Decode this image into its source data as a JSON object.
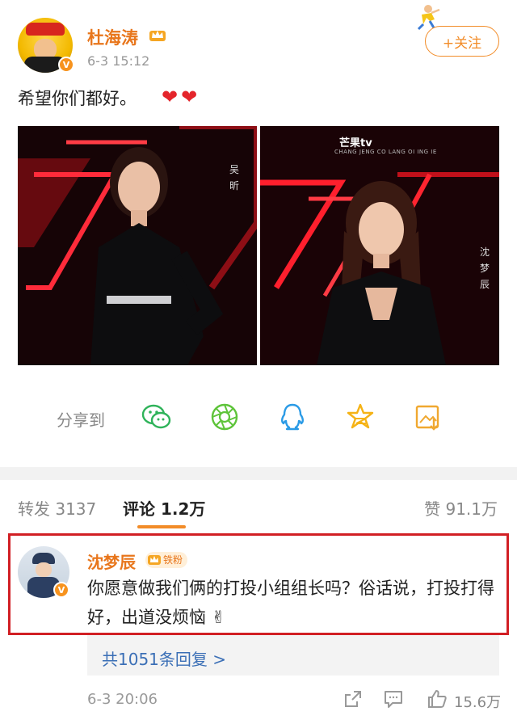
{
  "post": {
    "author": "杜海涛",
    "time": "6-3 15:12",
    "follow_label": "+关注",
    "text": "希望你们都好。",
    "hearts": [
      "❤",
      "❤"
    ],
    "photo_left_caption": [
      "吴",
      "昕"
    ],
    "photo_right_caption": [
      "沈",
      "梦",
      "辰"
    ],
    "photo_right_logo": "芒果tv",
    "photo_right_subtitle": "CHANG  JENG  CO  LANG  OI  ING  IE"
  },
  "share": {
    "label": "分享到",
    "icons": [
      "wechat-icon",
      "moments-icon",
      "qq-icon",
      "qzone-icon",
      "save-image-icon"
    ]
  },
  "tabs": {
    "repost": "转发 3137",
    "comments": "评论 1.2万",
    "likes": "赞 91.1万"
  },
  "comment": {
    "username": "沈梦辰",
    "badge": "铁粉",
    "text": "你愿意做我们俩的打投小组组长吗？俗话说，打投打得好，出道没烦恼 ✌",
    "replies_link": "共1051条回复 >",
    "time": "6-3 20:06",
    "likes": "15.6万"
  },
  "colors": {
    "accent": "#f28c28",
    "username": "#e8761c",
    "link": "#3b6fb6",
    "highlight": "#d11f24"
  }
}
